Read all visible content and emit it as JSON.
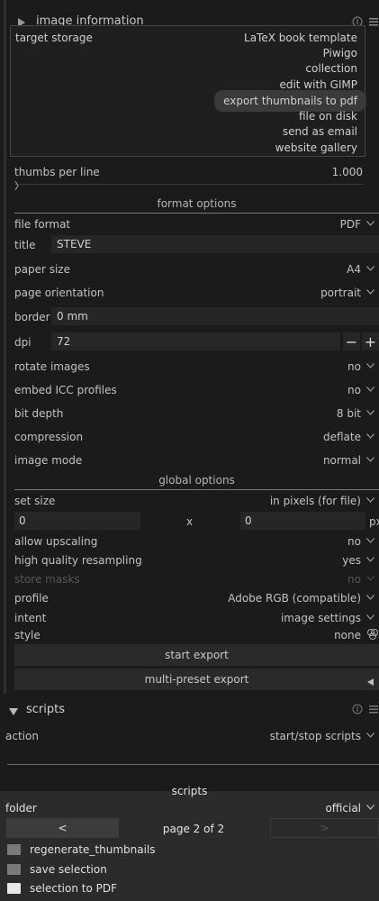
{
  "image_info_header": {
    "title": "image information"
  },
  "storage": {
    "label": "target storage",
    "options": [
      "LaTeX book template",
      "Piwigo",
      "collection",
      "edit with GIMP",
      "export thumbnails to pdf",
      "file on disk",
      "send as email",
      "website gallery"
    ],
    "highlighted": "export thumbnails to pdf"
  },
  "thumbs": {
    "label": "thumbs per line",
    "value": "1.000"
  },
  "format_options": {
    "title": "format options",
    "file_format": {
      "label": "file format",
      "value": "PDF"
    },
    "title_field": {
      "label": "title",
      "value": "STEVE"
    },
    "paper_size": {
      "label": "paper size",
      "value": "A4"
    },
    "page_orientation": {
      "label": "page orientation",
      "value": "portrait"
    },
    "border": {
      "label": "border",
      "value": "0 mm"
    },
    "dpi": {
      "label": "dpi",
      "value": "72",
      "minus": "−",
      "plus": "+"
    },
    "rotate_images": {
      "label": "rotate images",
      "value": "no"
    },
    "embed_icc": {
      "label": "embed ICC profiles",
      "value": "no"
    },
    "bit_depth": {
      "label": "bit depth",
      "value": "8 bit"
    },
    "compression": {
      "label": "compression",
      "value": "deflate"
    },
    "image_mode": {
      "label": "image mode",
      "value": "normal"
    }
  },
  "global_options": {
    "title": "global options",
    "set_size": {
      "label": "set size",
      "value": "in pixels (for file)"
    },
    "width": "0",
    "x": "x",
    "height": "0",
    "unit": "px",
    "allow_upscaling": {
      "label": "allow upscaling",
      "value": "no"
    },
    "hq_resampling": {
      "label": "high quality resampling",
      "value": "yes"
    },
    "store_masks": {
      "label": "store masks",
      "value": "no"
    },
    "profile": {
      "label": "profile",
      "value": "Adobe RGB (compatible)"
    },
    "intent": {
      "label": "intent",
      "value": "image settings"
    },
    "style": {
      "label": "style",
      "value": "none"
    }
  },
  "buttons": {
    "start_export": "start export",
    "multi_preset": "multi-preset export"
  },
  "scripts_header": {
    "title": "scripts"
  },
  "scripts": {
    "action": {
      "label": "action",
      "value": "start/stop scripts"
    },
    "subtitle": "scripts",
    "folder": {
      "label": "folder",
      "value": "official"
    },
    "prev": "<",
    "page": "page 2 of 2",
    "next": ">",
    "items": [
      "regenerate_thumbnails",
      "save selection",
      "selection to PDF"
    ]
  },
  "colors": {
    "bg": "#1b1b1b",
    "field": "#262626",
    "highlight": "#3a3a3a"
  }
}
